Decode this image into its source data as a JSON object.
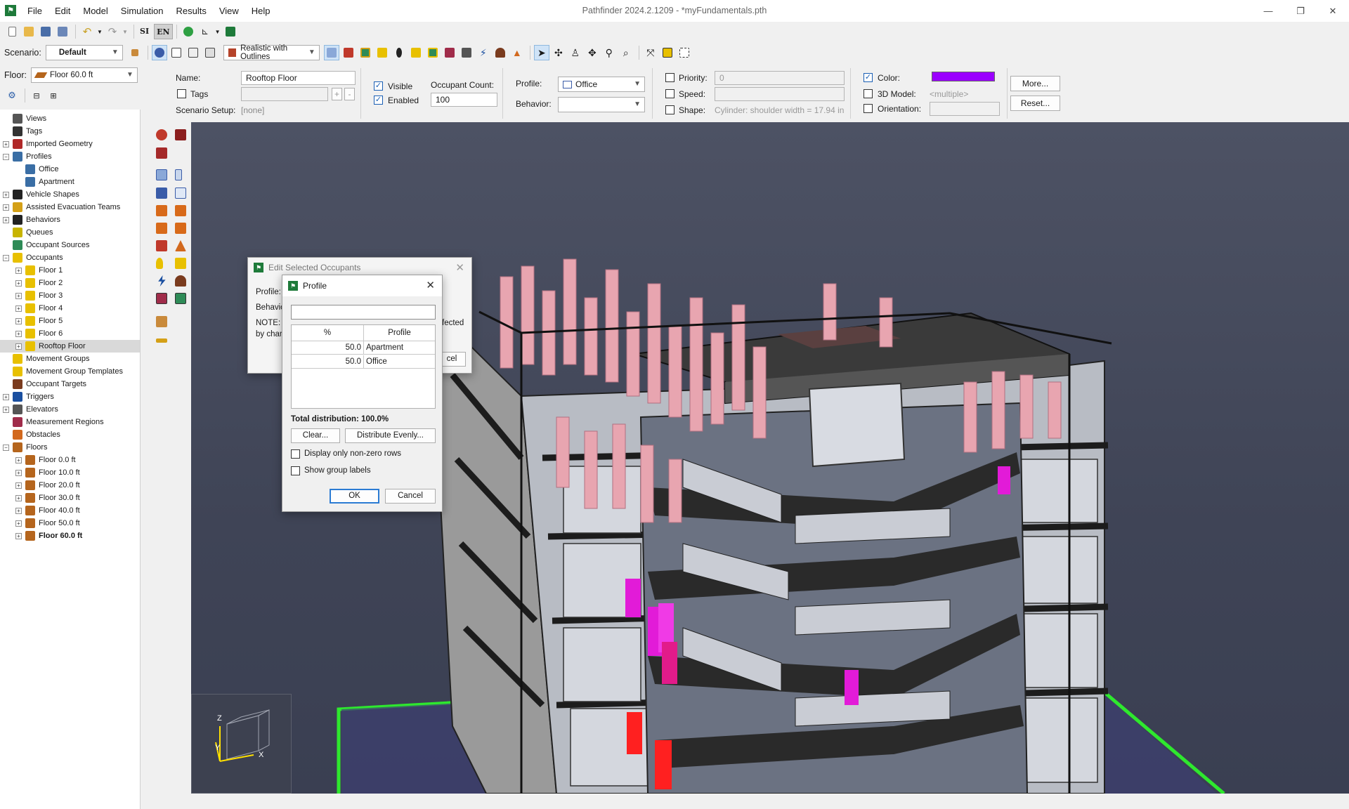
{
  "window": {
    "title": "Pathfinder 2024.2.1209 - *myFundamentals.pth",
    "app_icon_glyph": "⚑",
    "controls": [
      "—",
      "❐",
      "✕"
    ]
  },
  "menu": [
    "File",
    "Edit",
    "Model",
    "Simulation",
    "Results",
    "View",
    "Help"
  ],
  "toolbar1": {
    "si_label": "SI",
    "en_label": "EN"
  },
  "toolbar2": {
    "scenario_label": "Scenario:",
    "scenario_value": "Default",
    "render_mode": "Realistic with Outlines"
  },
  "floor_selector": {
    "label": "Floor:",
    "value": "Floor 60.0 ft"
  },
  "tree": {
    "items": [
      {
        "label": "Views",
        "indent": 0,
        "expander": "",
        "icon": "views-icon",
        "color": "#555555"
      },
      {
        "label": "Tags",
        "indent": 0,
        "expander": "",
        "icon": "tag-icon",
        "color": "#333333"
      },
      {
        "label": "Imported Geometry",
        "indent": 0,
        "expander": "+",
        "icon": "imported-geometry-icon",
        "color": "#b02828"
      },
      {
        "label": "Profiles",
        "indent": 0,
        "expander": "−",
        "icon": "profiles-icon",
        "color": "#3a6ea5"
      },
      {
        "label": "Office",
        "indent": 1,
        "expander": "",
        "icon": "profile-icon",
        "color": "#3a6ea5"
      },
      {
        "label": "Apartment",
        "indent": 1,
        "expander": "",
        "icon": "profile-icon",
        "color": "#3a6ea5"
      },
      {
        "label": "Vehicle Shapes",
        "indent": 0,
        "expander": "+",
        "icon": "wheelchair-icon",
        "color": "#222222"
      },
      {
        "label": "Assisted Evacuation Teams",
        "indent": 0,
        "expander": "+",
        "icon": "team-icon",
        "color": "#d4a017"
      },
      {
        "label": "Behaviors",
        "indent": 0,
        "expander": "+",
        "icon": "behaviors-icon",
        "color": "#222222"
      },
      {
        "label": "Queues",
        "indent": 0,
        "expander": "",
        "icon": "queue-icon",
        "color": "#c8b400"
      },
      {
        "label": "Occupant Sources",
        "indent": 0,
        "expander": "",
        "icon": "occupant-source-icon",
        "color": "#2e8b57"
      },
      {
        "label": "Occupants",
        "indent": 0,
        "expander": "−",
        "icon": "occupants-icon",
        "color": "#e8c000"
      },
      {
        "label": "Floor 1",
        "indent": 1,
        "expander": "+",
        "icon": "occupants-icon",
        "color": "#e8c000"
      },
      {
        "label": "Floor 2",
        "indent": 1,
        "expander": "+",
        "icon": "occupants-icon",
        "color": "#e8c000"
      },
      {
        "label": "Floor 3",
        "indent": 1,
        "expander": "+",
        "icon": "occupants-icon",
        "color": "#e8c000"
      },
      {
        "label": "Floor 4",
        "indent": 1,
        "expander": "+",
        "icon": "occupants-icon",
        "color": "#e8c000"
      },
      {
        "label": "Floor 5",
        "indent": 1,
        "expander": "+",
        "icon": "occupants-icon",
        "color": "#e8c000"
      },
      {
        "label": "Floor 6",
        "indent": 1,
        "expander": "+",
        "icon": "occupants-icon",
        "color": "#e8c000"
      },
      {
        "label": "Rooftop Floor",
        "indent": 1,
        "expander": "+",
        "icon": "occupants-icon",
        "color": "#e8c000",
        "selected": true
      },
      {
        "label": "Movement Groups",
        "indent": 0,
        "expander": "",
        "icon": "movement-group-icon",
        "color": "#e8c000"
      },
      {
        "label": "Movement Group Templates",
        "indent": 0,
        "expander": "",
        "icon": "movement-template-icon",
        "color": "#e8c000"
      },
      {
        "label": "Occupant Targets",
        "indent": 0,
        "expander": "",
        "icon": "target-icon",
        "color": "#7a3b1e"
      },
      {
        "label": "Triggers",
        "indent": 0,
        "expander": "+",
        "icon": "trigger-icon",
        "color": "#1a4fa0"
      },
      {
        "label": "Elevators",
        "indent": 0,
        "expander": "+",
        "icon": "elevator-icon",
        "color": "#555555"
      },
      {
        "label": "Measurement Regions",
        "indent": 0,
        "expander": "",
        "icon": "measurement-region-icon",
        "color": "#a02c4a"
      },
      {
        "label": "Obstacles",
        "indent": 0,
        "expander": "",
        "icon": "obstacle-icon",
        "color": "#d2691e"
      },
      {
        "label": "Floors",
        "indent": 0,
        "expander": "−",
        "icon": "floor-icon",
        "color": "#b5651d"
      },
      {
        "label": "Floor 0.0 ft",
        "indent": 1,
        "expander": "+",
        "icon": "floor-icon",
        "color": "#b5651d"
      },
      {
        "label": "Floor 10.0 ft",
        "indent": 1,
        "expander": "+",
        "icon": "floor-icon",
        "color": "#b5651d"
      },
      {
        "label": "Floor 20.0 ft",
        "indent": 1,
        "expander": "+",
        "icon": "floor-icon",
        "color": "#b5651d"
      },
      {
        "label": "Floor 30.0 ft",
        "indent": 1,
        "expander": "+",
        "icon": "floor-icon",
        "color": "#b5651d"
      },
      {
        "label": "Floor 40.0 ft",
        "indent": 1,
        "expander": "+",
        "icon": "floor-icon",
        "color": "#b5651d"
      },
      {
        "label": "Floor 50.0 ft",
        "indent": 1,
        "expander": "+",
        "icon": "floor-icon",
        "color": "#b5651d"
      },
      {
        "label": "Floor 60.0 ft",
        "indent": 1,
        "expander": "+",
        "icon": "floor-icon",
        "color": "#b5651d",
        "bold": true
      }
    ]
  },
  "props": {
    "name_label": "Name:",
    "name_value": "Rooftop Floor",
    "tags_label": "Tags",
    "tag_add": "+",
    "tag_remove": "-",
    "scenario_setup_label": "Scenario Setup:",
    "scenario_setup_value": "[none]",
    "visible_label": "Visible",
    "enabled_label": "Enabled",
    "occupant_count_label": "Occupant Count:",
    "occupant_count_value": "100",
    "profile_label": "Profile:",
    "profile_value": "Office",
    "behavior_label": "Behavior:",
    "behavior_value": "",
    "priority_label": "Priority:",
    "priority_value": "0",
    "speed_label": "Speed:",
    "speed_value": "",
    "shape_label": "Shape:",
    "shape_value": "Cylinder: shoulder width = 17.94 in",
    "color_label": "Color:",
    "color_value": "#9b00ff",
    "model_label": "3D Model:",
    "model_value": "<multiple>",
    "orientation_label": "Orientation:",
    "orientation_value": "",
    "more_button": "More...",
    "reset_button": "Reset..."
  },
  "edit_dialog": {
    "title": "Edit Selected Occupants",
    "profile_label": "Profile:",
    "behavior_label": "Behavio",
    "note_text": "NOTE:",
    "note_text2": "by char",
    "note_right": "fected",
    "cancel_partial": "cel"
  },
  "profile_dialog": {
    "title": "Profile",
    "filter_value": "",
    "columns": [
      "%",
      "Profile"
    ],
    "rows": [
      {
        "percent": "50.0",
        "profile": "Apartment"
      },
      {
        "percent": "50.0",
        "profile": "Office"
      }
    ],
    "total": "Total distribution: 100.0%",
    "clear_button": "Clear...",
    "distribute_button": "Distribute Evenly...",
    "nonzero_label": "Display only non-zero rows",
    "group_labels_label": "Show group labels",
    "ok_button": "OK",
    "cancel_button": "Cancel"
  },
  "viewport": {
    "axes": {
      "x": "X",
      "y": "Y",
      "z": "Z"
    }
  }
}
